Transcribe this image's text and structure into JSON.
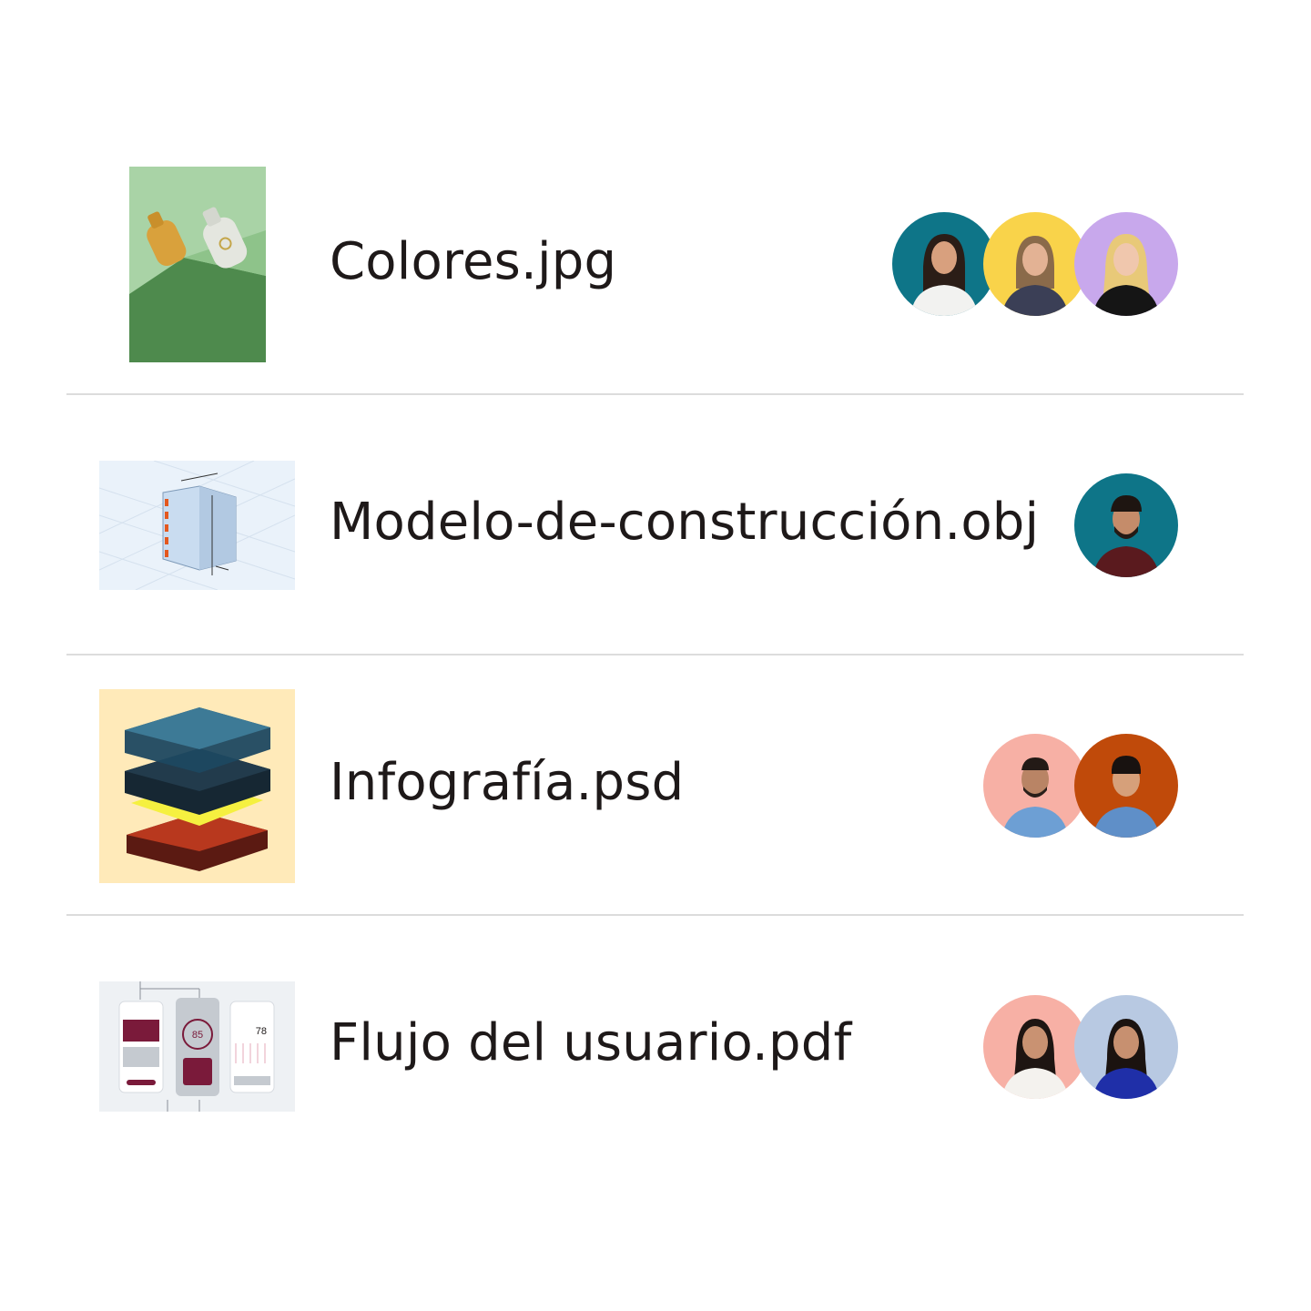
{
  "files": [
    {
      "name": "Colores.jpg",
      "thumb_icon": "bottles-image-thumbnail",
      "avatars": [
        {
          "bg": "#0e7588",
          "name": "avatar-1"
        },
        {
          "bg": "#f9d34a",
          "name": "avatar-2"
        },
        {
          "bg": "#c8a8ec",
          "name": "avatar-3"
        }
      ]
    },
    {
      "name": "Modelo-de-construcción.obj",
      "thumb_icon": "building-model-thumbnail",
      "avatars": [
        {
          "bg": "#0e7588",
          "name": "avatar-1"
        }
      ]
    },
    {
      "name": "Infografía.psd",
      "thumb_icon": "layers-infographic-thumbnail",
      "avatars": [
        {
          "bg": "#f7b0a5",
          "name": "avatar-1"
        },
        {
          "bg": "#c04a0a",
          "name": "avatar-2"
        }
      ]
    },
    {
      "name": "Flujo del usuario.pdf",
      "thumb_icon": "user-flow-thumbnail",
      "thumb_texts": {
        "gauge": "85",
        "score": "78"
      },
      "avatars": [
        {
          "bg": "#f7b0a5",
          "name": "avatar-1"
        },
        {
          "bg": "#b8c9e2",
          "name": "avatar-2"
        }
      ]
    }
  ]
}
